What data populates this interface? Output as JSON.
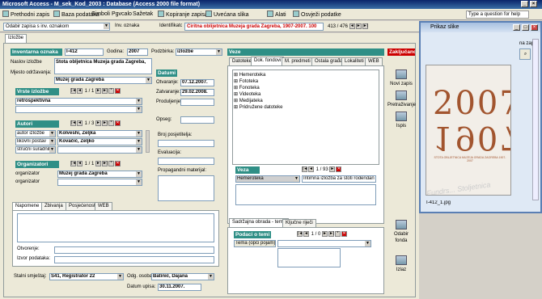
{
  "app": {
    "title": "Microsoft Access - M_sek_Kod_2003 : Database (Access 2000 file format)",
    "help_placeholder": "Type a question for help"
  },
  "menu": [
    "Prethodni zapis",
    "Baza podataka",
    "Simboli",
    "Pgvcalo",
    "Sažetak",
    "Kopiranje zapisa",
    "Uvećana slika",
    "Alati",
    "Osvježi podatke"
  ],
  "toolbar": {
    "search_combo": "Odabir zapisa s inv. oznakom",
    "inv_label": "Inv. oznaka",
    "id_label": "Identifikator:",
    "title": "Ciritna oblijetnica Muzeja grada Zagreba, 1907-2007. 100",
    "counter": "413 / 476"
  },
  "tabs": {
    "main": "Izložbe"
  },
  "left": {
    "inv_label": "Inventarna oznaka",
    "inv_value": "I-412",
    "godina_label": "Godina:",
    "godina": "2007",
    "podzbirka_label": "Podzbirka:",
    "podzbirka": "izložbe",
    "naslov_label": "Naslov izložbe",
    "naslov": "Stota obljetnica Muzeja grada Zagreba,",
    "mjesto_label": "Mjesto održavanja:",
    "mjesto": "Muzej grada Zagreba",
    "vrste_hdr": "Vrste izložbe",
    "vrste_nav": "1 / 1",
    "vrste_value": "retrospektivna",
    "autori_hdr": "Autori",
    "autori_nav": "1 / 3",
    "autori": [
      {
        "role": "autor izložbe",
        "name": "Kolveshi, Željka"
      },
      {
        "role": "likovni postav",
        "name": "Kovačić, Željko"
      },
      {
        "role": "stručni suradnik",
        "name": ""
      }
    ],
    "org_hdr": "Organizatori",
    "org_nav": "1 / 1",
    "org": [
      {
        "role": "organizator",
        "name": "Muzej grada Zagreba"
      },
      {
        "role": "organizator",
        "name": ""
      }
    ],
    "datumi_hdr": "Datumi",
    "otvaranje_label": "Otvaranje:",
    "otvaranje": "07.12.2007.",
    "zatvaranje_label": "Zatvaranje:",
    "zatvaranje": "29.02.2008.",
    "produljenje_label": "Produljenje:",
    "opseg_label": "Opseg:",
    "posjetitelja_label": "Broj posjetitelja:",
    "evaluacija_label": "Evaluacija:",
    "propag_label": "Propagandni materijal:",
    "subtabs": [
      "Napomene",
      "Zbivanja",
      "Posjećenost",
      "WEB"
    ],
    "otvorenje_label": "Otvorenje:",
    "izvor_label": "Izvor podataka:",
    "smjestaj_label": "Stalni smještaj:",
    "smjestaj": "S41, Registrator 22",
    "odg_label": "Odg. osoba:",
    "odg": "Batinić, Dajana",
    "datum_label": "Datum upisa:",
    "datum": "30.11.2007."
  },
  "veze": {
    "hdr": "Veze",
    "tabs": [
      "Datoteke",
      "Dok. fondovi",
      "M. predmeti",
      "Ostala građa",
      "Lokaliteti",
      "WEB"
    ],
    "tree": [
      "Hemeroteka",
      "Fototeka",
      "Fonoteka",
      "Videoteka",
      "Medijateka",
      "Pridružene datoteke"
    ],
    "veza_hdr": "Veza",
    "veza_nav": "1 / 93",
    "veza_row": {
      "type": "Hemeroteka",
      "value": "Intimna izložba za stoti rođendan"
    },
    "bottom_tabs": [
      "Sadržajna obrada - teme",
      "Ključne riječi"
    ],
    "teme_hdr": "Podaci o temi",
    "teme_nav": "1 / 0",
    "tema_label": "Tema (opći pojam)"
  },
  "status": {
    "zakljucano": "Zaključano:"
  },
  "buttons": {
    "novi": "Novi zapis",
    "pretrazivanje": "Pretraživanje",
    "ispis": "Ispis",
    "odabir": "Odabir fonda",
    "izlaz": "Izlaz"
  },
  "image_window": {
    "title": "Prikaz slike",
    "zapis_label": "na zapis:",
    "filename": "I-412_1.jpg",
    "poster_top": "2007",
    "poster_bottom": "1907",
    "poster_subtitle": "STOTA OBLJETNICA MUZEJA GRADA ZAGREBA 1907-2007",
    "poster_slogan": "Fundrs... Stoljetnica"
  }
}
